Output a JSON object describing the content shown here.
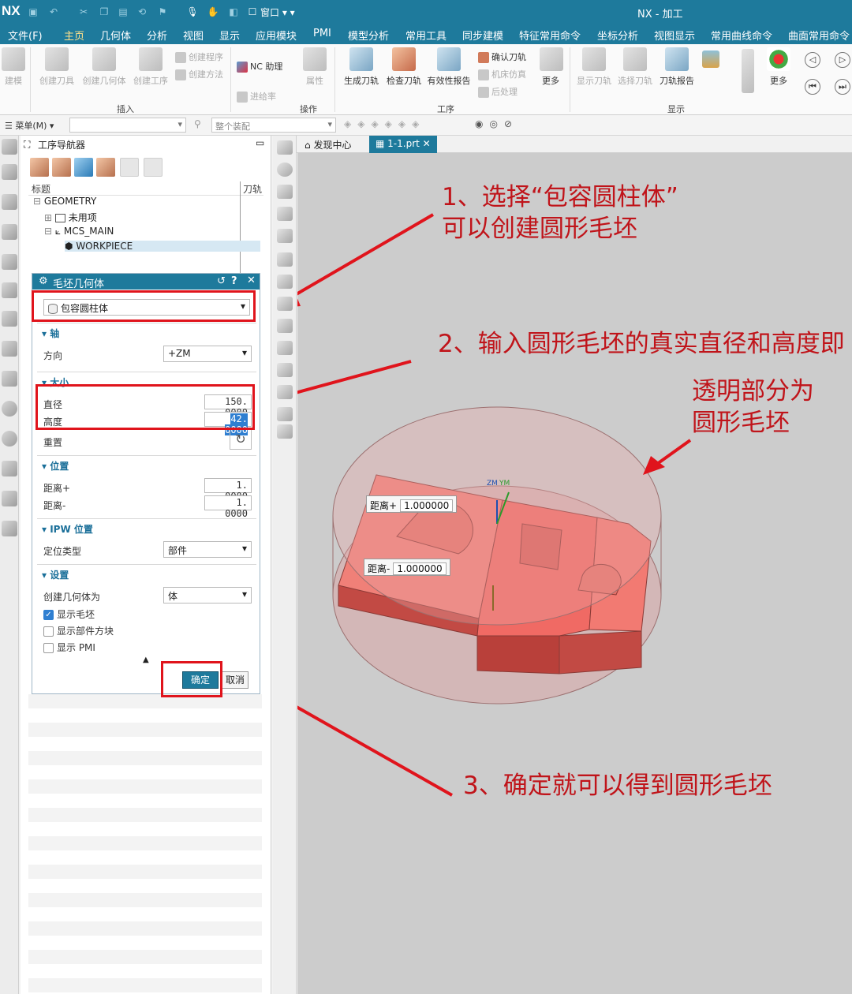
{
  "titlebar": {
    "logo": "NX",
    "window_menu": "窗口",
    "title": "NX - 加工"
  },
  "menubar": {
    "items": [
      "文件(F)",
      "主页",
      "几何体",
      "分析",
      "视图",
      "显示",
      "应用模块",
      "PMI",
      "模型分析",
      "常用工具",
      "同步建模",
      "特征常用命令",
      "坐标分析",
      "视图显示",
      "常用曲线命令",
      "曲面常用命令"
    ],
    "active": "主页"
  },
  "ribbon": {
    "create_label": "建模",
    "insert": [
      "创建刀具",
      "创建几何体",
      "创建工序"
    ],
    "insert_small": [
      "创建程序",
      "创建方法"
    ],
    "nc_assistant": "NC 助理",
    "feed_rate": "进给率",
    "attribute": "属性",
    "procedure": [
      "生成刀轨",
      "检查刀轨",
      "有效性报告"
    ],
    "procedure_small": [
      "确认刀轨",
      "机床仿真",
      "后处理"
    ],
    "more": "更多",
    "display": [
      "显示刀轨",
      "选择刀轨",
      "刀轨报告"
    ],
    "groups": {
      "insert": "插入",
      "operation": "操作",
      "procedure": "工序",
      "display": "显示"
    }
  },
  "toolbar2": {
    "menu": "菜单(M)",
    "filter_placeholder": "整个装配"
  },
  "navigator": {
    "title": "工序导航器",
    "col_title": "标题",
    "col_tool": "刀轨",
    "tree": [
      "GEOMETRY",
      "未用项",
      "MCS_MAIN",
      "WORKPIECE"
    ]
  },
  "dialog": {
    "title": "毛坯几何体",
    "type": "包容圆柱体",
    "axis_section": "轴",
    "direction_label": "方向",
    "direction_value": "+ZM",
    "size_section": "大小",
    "diameter_label": "直径",
    "diameter_value": "150. 0000",
    "height_label": "高度",
    "height_value": "42. 0000",
    "reset_label": "重置",
    "position_section": "位置",
    "dist_plus_label": "距离+",
    "dist_plus_value": "1. 0000",
    "dist_minus_label": "距离-",
    "dist_minus_value": "1. 0000",
    "ipw_section": "IPW 位置",
    "locate_label": "定位类型",
    "locate_value": "部件",
    "settings_section": "设置",
    "create_as_label": "创建几何体为",
    "create_as_value": "体",
    "show_blank": "显示毛坯",
    "show_block": "显示部件方块",
    "show_pmi": "显示 PMI",
    "ok": "确定",
    "cancel": "取消"
  },
  "tabs": {
    "discover": "发现中心",
    "part": "1-1.prt"
  },
  "graphics": {
    "tag_plus_label": "距离+",
    "tag_plus_value": "1.000000",
    "tag_minus_label": "距离-",
    "tag_minus_value": "1.000000",
    "axis_zm": "ZM",
    "axis_ym": "YM"
  },
  "annotations": {
    "step1_line1": "1、选择“包容圆柱体”",
    "step1_line2": "可以创建圆形毛坯",
    "step2": "2、输入圆形毛坯的真实直径和高度即",
    "note_line1": "透明部分为",
    "note_line2": "圆形毛坯",
    "step3": "3、确定就可以得到圆形毛坯"
  },
  "colors": {
    "brand": "#1e7a9c",
    "annotation_red": "#e0141c",
    "part": "#f06a64",
    "blank": "#e8a7a7"
  }
}
